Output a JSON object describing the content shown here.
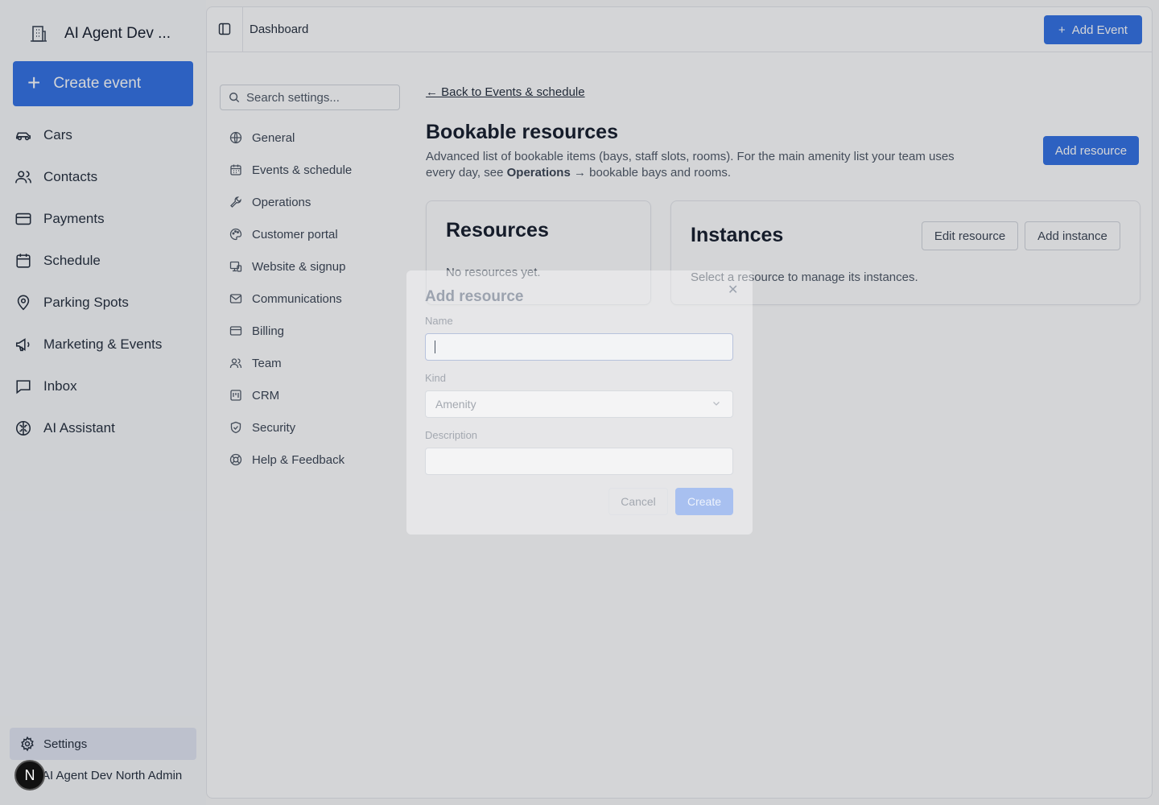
{
  "sidebar": {
    "org_name": "AI Agent Dev ...",
    "create_label": "Create event",
    "items": [
      {
        "label": "Cars",
        "icon": "car-icon"
      },
      {
        "label": "Contacts",
        "icon": "users-icon"
      },
      {
        "label": "Payments",
        "icon": "credit-card-icon"
      },
      {
        "label": "Schedule",
        "icon": "calendar-icon"
      },
      {
        "label": "Parking Spots",
        "icon": "map-pin-icon"
      },
      {
        "label": "Marketing & Events",
        "icon": "megaphone-icon"
      },
      {
        "label": "Inbox",
        "icon": "message-square-icon"
      },
      {
        "label": "AI Assistant",
        "icon": "brain-icon"
      }
    ],
    "settings_label": "Settings",
    "user_initial": "N",
    "user_name": "AI Agent Dev North Admin"
  },
  "topbar": {
    "breadcrumb": "Dashboard",
    "add_event_label": "Add Event"
  },
  "settings_nav": {
    "search_placeholder": "Search settings...",
    "items": [
      {
        "label": "General",
        "icon": "globe-icon"
      },
      {
        "label": "Events & schedule",
        "icon": "calendar-icon"
      },
      {
        "label": "Operations",
        "icon": "wrench-icon"
      },
      {
        "label": "Customer portal",
        "icon": "palette-icon"
      },
      {
        "label": "Website & signup",
        "icon": "monitor-icon"
      },
      {
        "label": "Communications",
        "icon": "mail-icon"
      },
      {
        "label": "Billing",
        "icon": "credit-card-icon"
      },
      {
        "label": "Team",
        "icon": "users-icon"
      },
      {
        "label": "CRM",
        "icon": "kanban-icon"
      },
      {
        "label": "Security",
        "icon": "shield-icon"
      },
      {
        "label": "Help & Feedback",
        "icon": "life-buoy-icon"
      }
    ]
  },
  "content": {
    "back_link": "← Back to Events & schedule",
    "title": "Bookable resources",
    "desc_part1": "Advanced list of bookable items (bays, staff slots, rooms). For the main amenity list your team uses every day, see ",
    "desc_bold": "Operations",
    "desc_part2": " → bookable bays and rooms.",
    "add_resource_label": "Add resource",
    "resources": {
      "title": "Resources",
      "empty_text": "No resources yet."
    },
    "instances": {
      "title": "Instances",
      "edit_label": "Edit resource",
      "add_label": "Add instance",
      "empty_text": "Select a resource to manage its instances."
    }
  },
  "modal": {
    "title": "Add resource",
    "close_glyph": "✕",
    "name_label": "Name",
    "name_value": "",
    "kind_label": "Kind",
    "kind_value": "Amenity",
    "description_label": "Description",
    "description_value": "",
    "cancel_label": "Cancel",
    "create_label": "Create"
  },
  "colors": {
    "accent": "#2f6fe4",
    "sidebar_bg": "#f8f9fb",
    "active_item_bg": "#e3e6f3"
  }
}
